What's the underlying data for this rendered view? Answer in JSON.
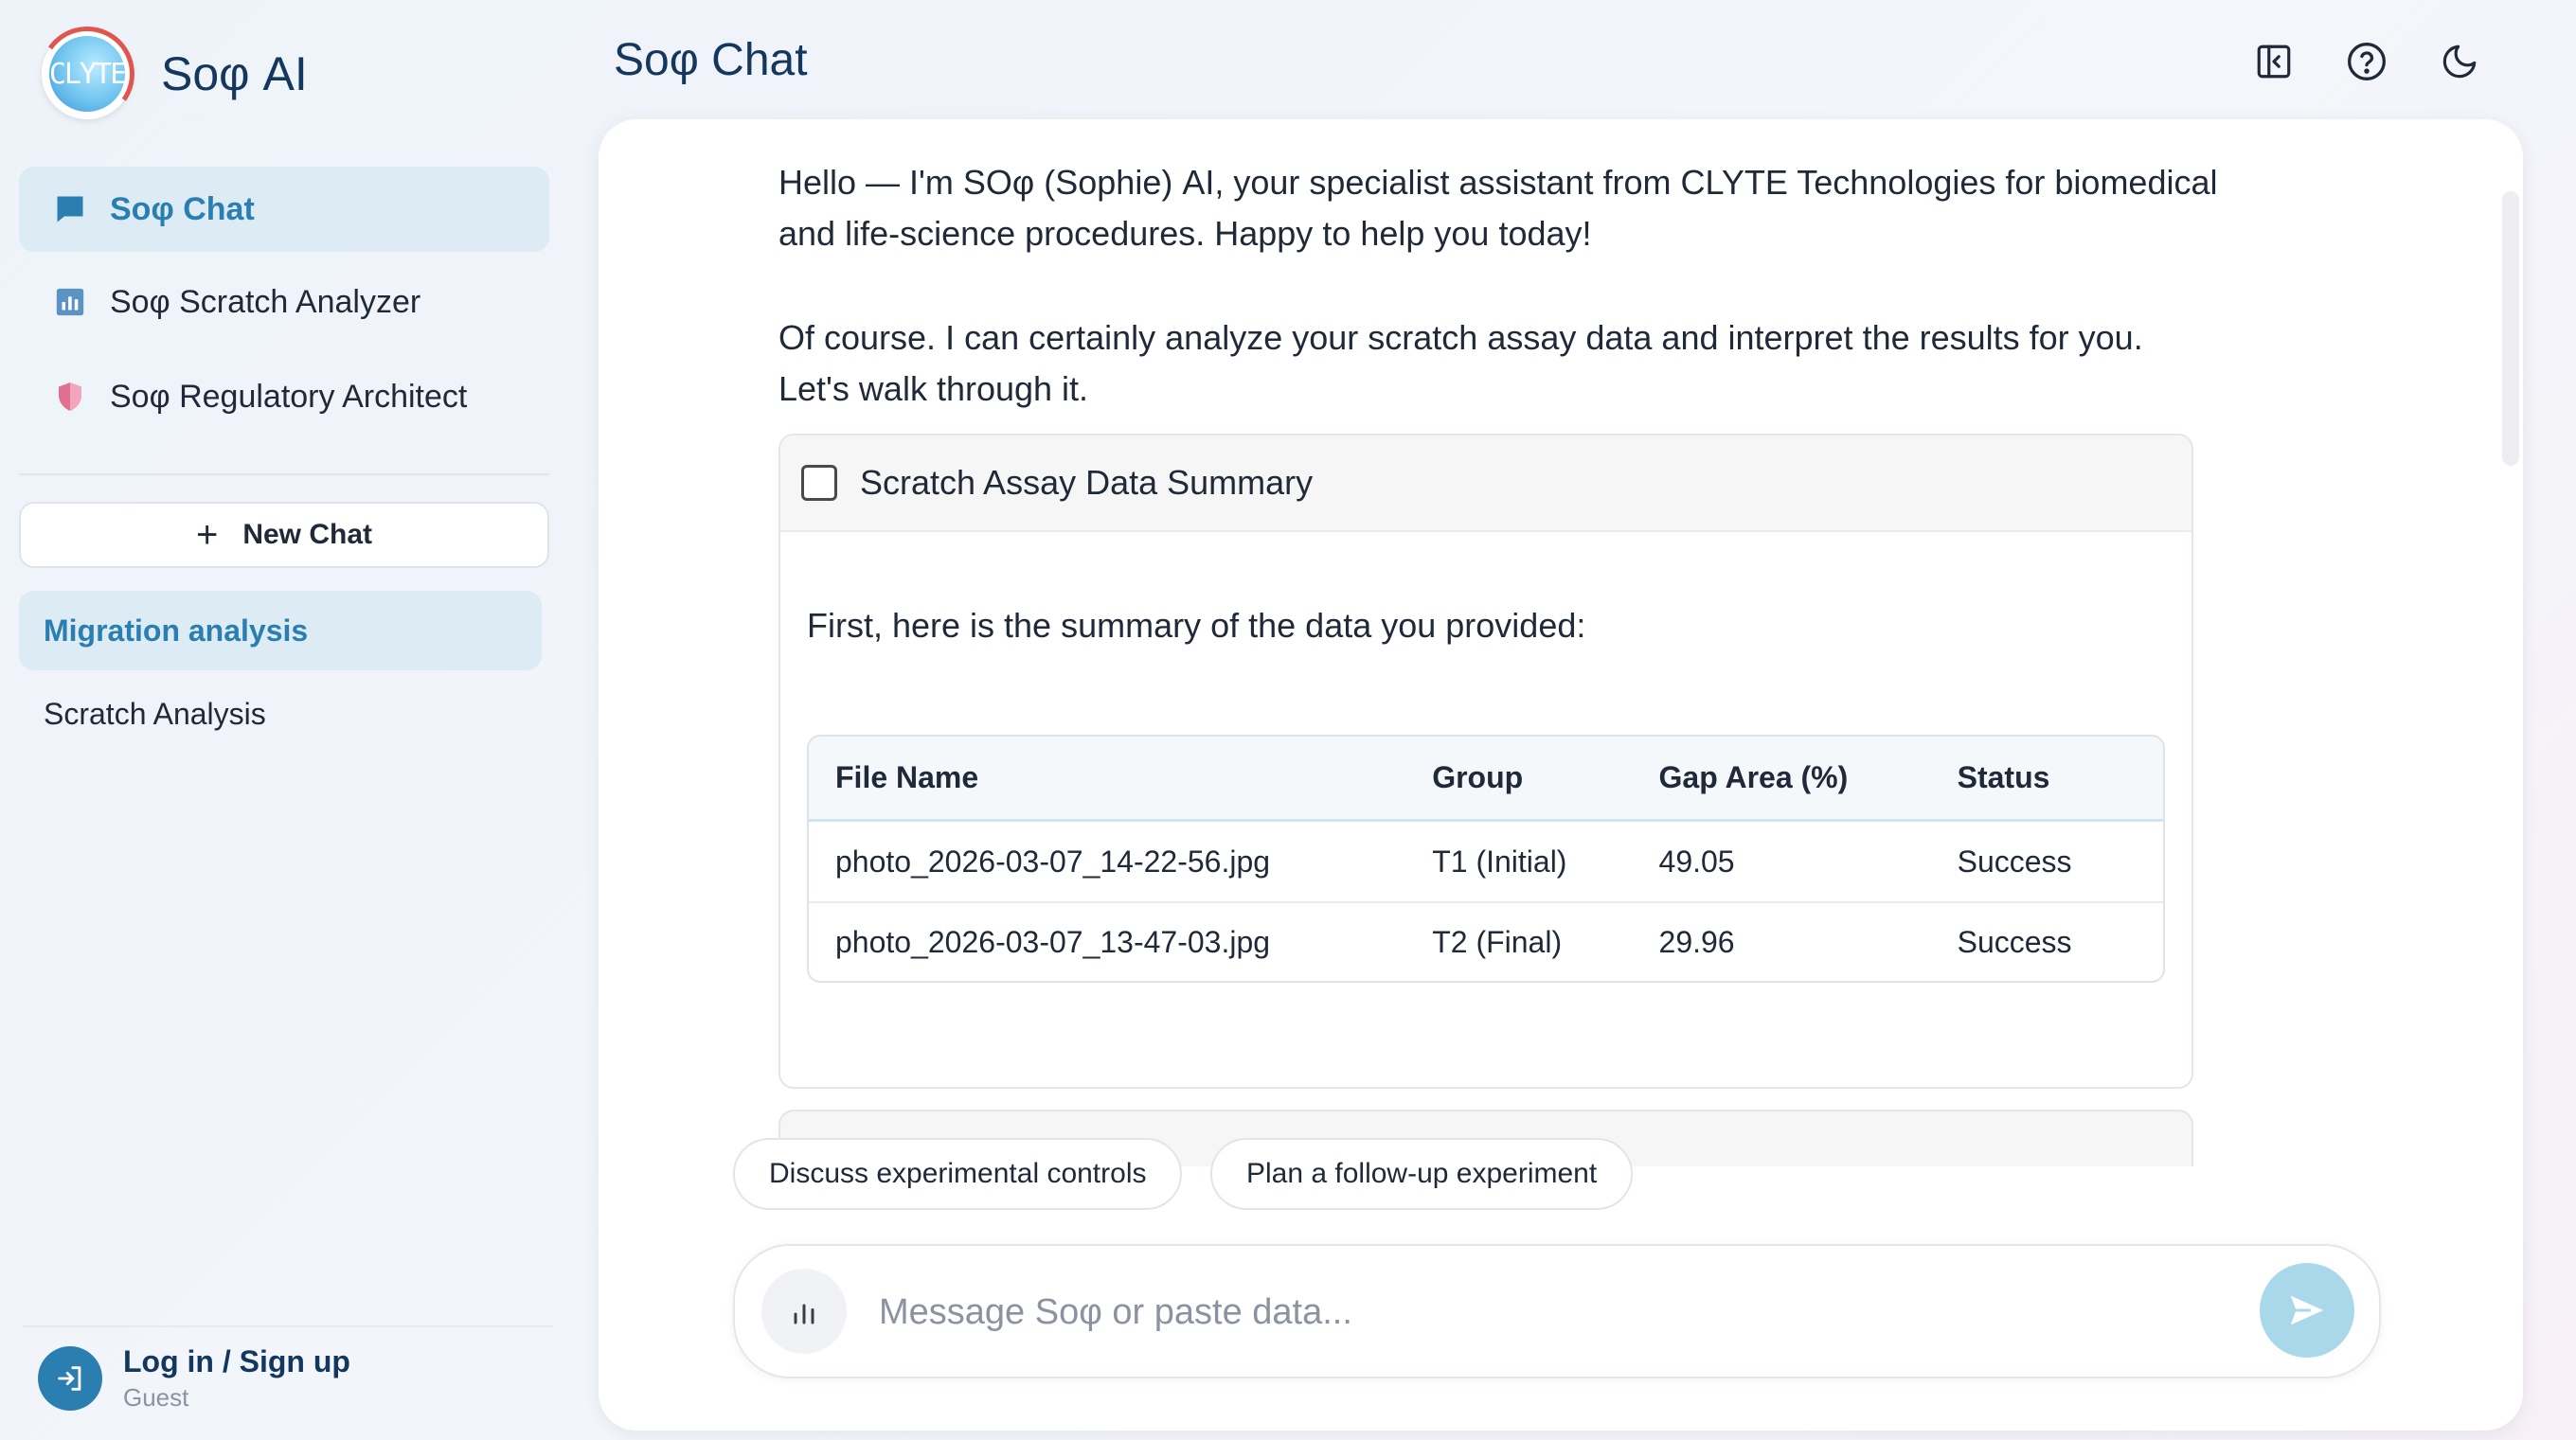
{
  "brand": {
    "name": "Soφ AI",
    "logo_text": "CLYTE"
  },
  "nav": [
    {
      "label": "Soφ Chat",
      "icon": "chat-bubble-icon",
      "active": true
    },
    {
      "label": "Soφ Scratch Analyzer",
      "icon": "bar-chart-icon",
      "active": false
    },
    {
      "label": "Soφ Regulatory Architect",
      "icon": "shield-icon",
      "active": false
    }
  ],
  "new_chat": {
    "label": "New Chat"
  },
  "history": [
    {
      "label": "Migration analysis",
      "active": true
    },
    {
      "label": "Scratch Analysis",
      "active": false
    }
  ],
  "account": {
    "title": "Log in / Sign up",
    "subtitle": "Guest"
  },
  "header": {
    "title": "Soφ Chat"
  },
  "messages": {
    "greeting": "Hello — I'm SOφ (Sophie) AI, your specialist assistant from CLYTE Technologies for biomedical and life-science procedures. Happy to help you today!",
    "reply": "Of course. I can certainly analyze your scratch assay data and interpret the results for you. Let's walk through it."
  },
  "summary_card": {
    "title": "Scratch Assay Data Summary",
    "intro": "First, here is the summary of the data you provided:",
    "table": {
      "headers": [
        "File Name",
        "Group",
        "Gap Area (%)",
        "Status"
      ],
      "rows": [
        [
          "photo_2026-03-07_14-22-56.jpg",
          "T1 (Initial)",
          "49.05",
          "Success"
        ],
        [
          "photo_2026-03-07_13-47-03.jpg",
          "T2 (Final)",
          "29.96",
          "Success"
        ]
      ]
    }
  },
  "suggestions": [
    "Discuss experimental controls",
    "Plan a follow-up experiment"
  ],
  "composer": {
    "placeholder": "Message Soφ or paste data..."
  },
  "colors": {
    "accent": "#2b7fb0",
    "active_bg": "#dcebf4",
    "title": "#14375e",
    "send": "#a8d8ea"
  }
}
